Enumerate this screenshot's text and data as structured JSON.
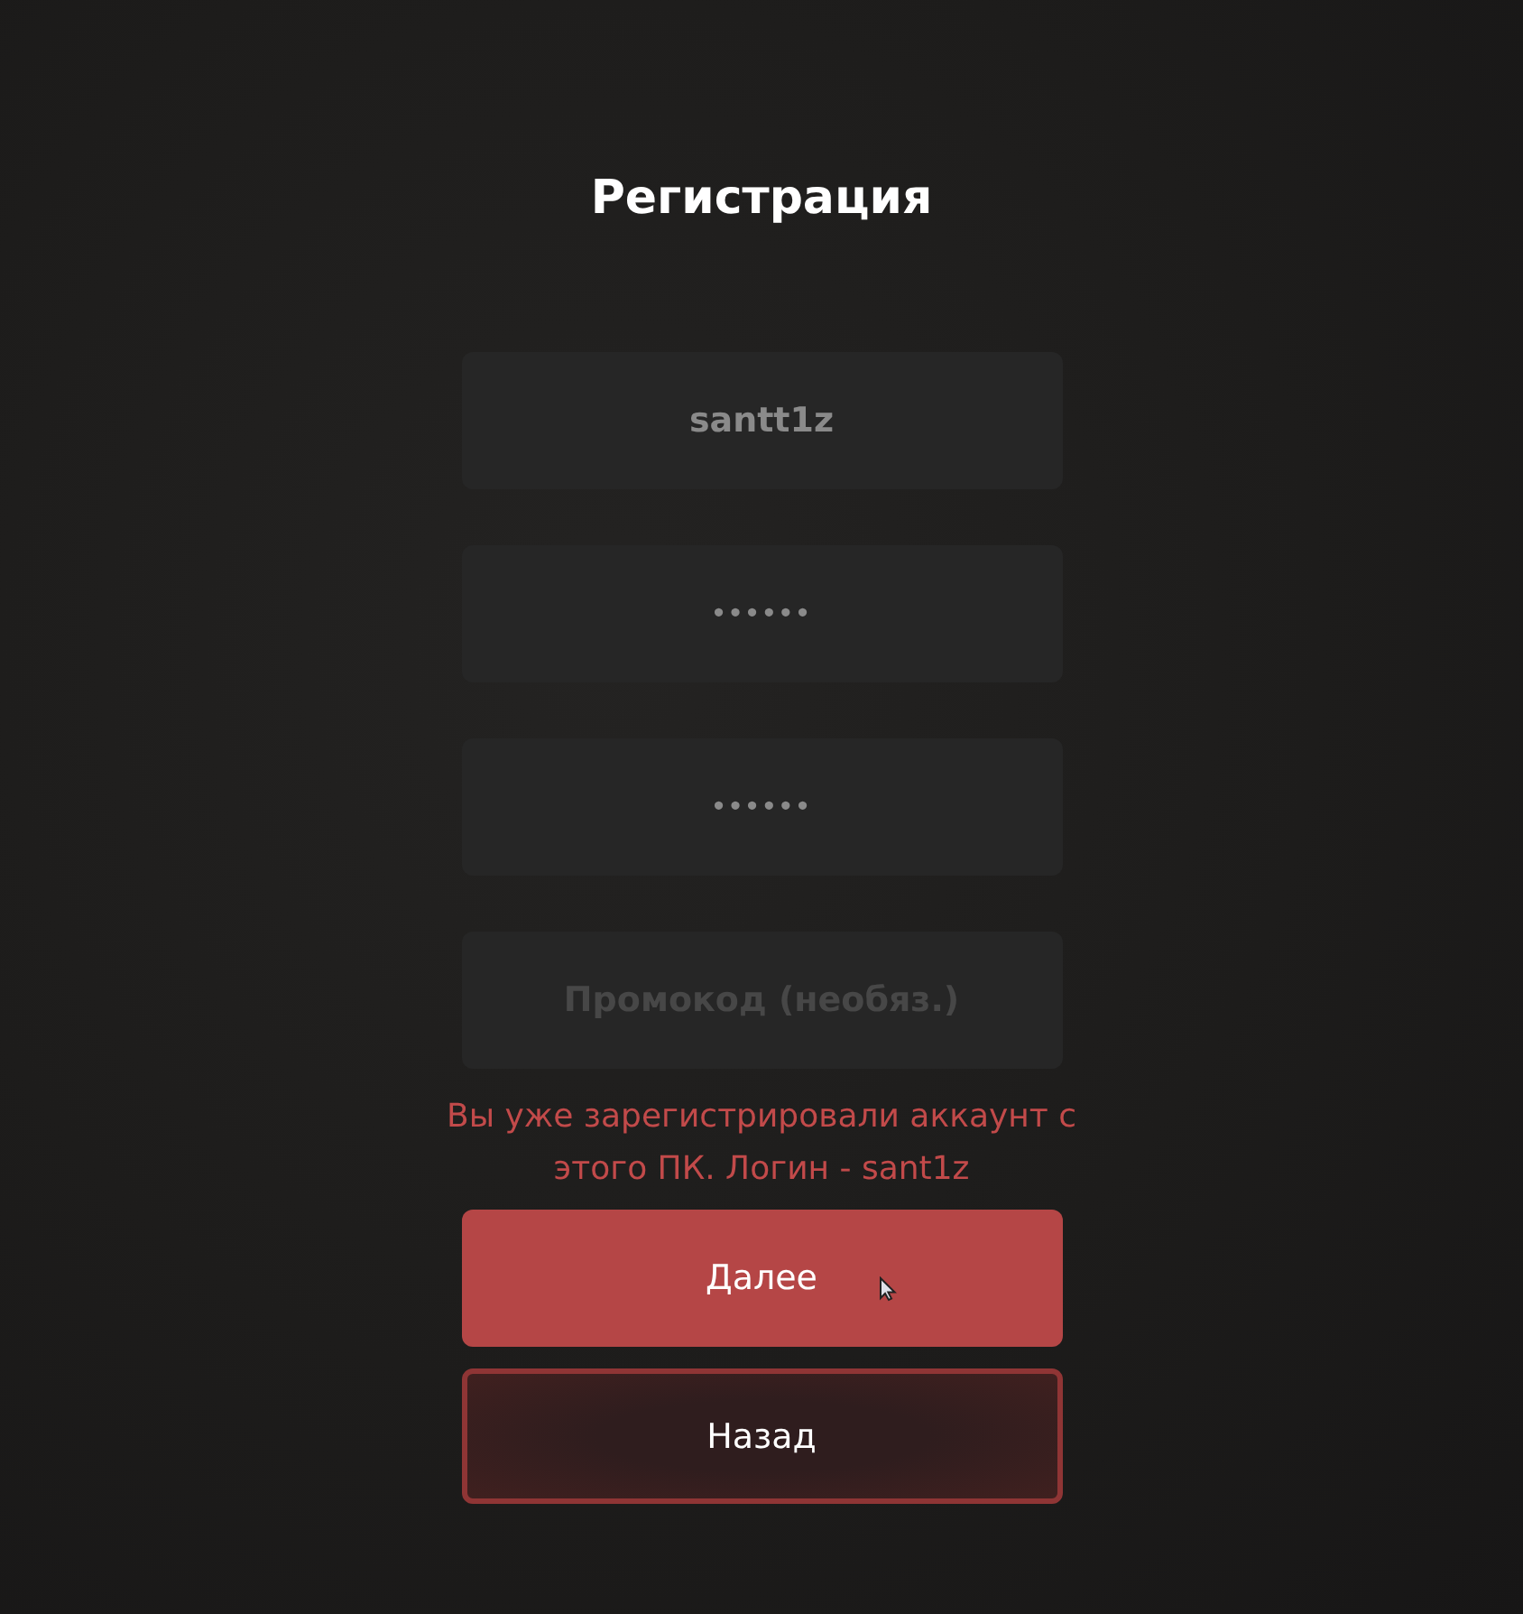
{
  "title": "Регистрация",
  "fields": [
    {
      "kind": "text",
      "value": "santt1z"
    },
    {
      "kind": "password",
      "value": "••••••"
    },
    {
      "kind": "password",
      "value": "••••••"
    },
    {
      "kind": "text",
      "placeholder": "Промокод (необяз.)"
    }
  ],
  "error": "Вы уже зарегистрировали аккаунт с этого ПК. Логин - sant1z",
  "buttons": [
    {
      "kind": "primary",
      "label": "Далее"
    },
    {
      "kind": "secondary",
      "label": "Назад"
    }
  ]
}
